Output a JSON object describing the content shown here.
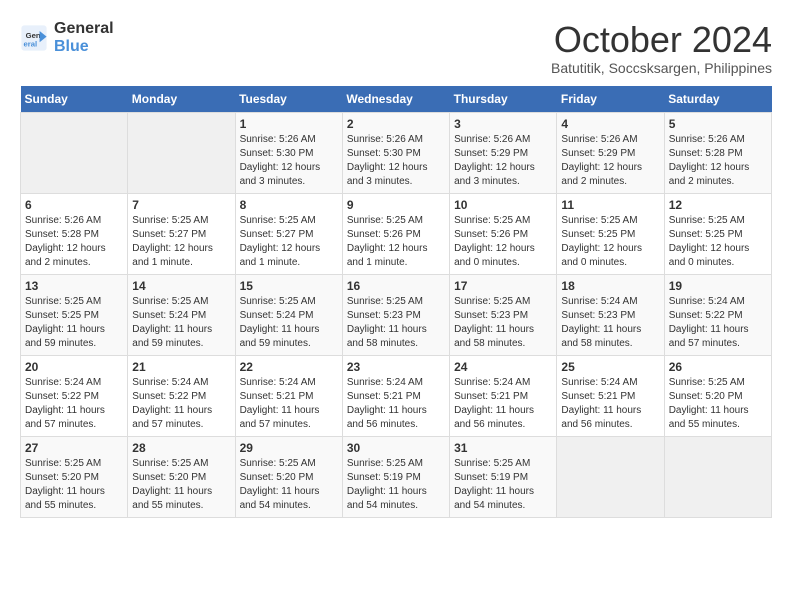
{
  "logo": {
    "line1": "General",
    "line2": "Blue"
  },
  "title": "October 2024",
  "subtitle": "Batutitik, Soccsksargen, Philippines",
  "weekdays": [
    "Sunday",
    "Monday",
    "Tuesday",
    "Wednesday",
    "Thursday",
    "Friday",
    "Saturday"
  ],
  "weeks": [
    [
      {
        "day": "",
        "info": ""
      },
      {
        "day": "",
        "info": ""
      },
      {
        "day": "1",
        "info": "Sunrise: 5:26 AM\nSunset: 5:30 PM\nDaylight: 12 hours and 3 minutes."
      },
      {
        "day": "2",
        "info": "Sunrise: 5:26 AM\nSunset: 5:30 PM\nDaylight: 12 hours and 3 minutes."
      },
      {
        "day": "3",
        "info": "Sunrise: 5:26 AM\nSunset: 5:29 PM\nDaylight: 12 hours and 3 minutes."
      },
      {
        "day": "4",
        "info": "Sunrise: 5:26 AM\nSunset: 5:29 PM\nDaylight: 12 hours and 2 minutes."
      },
      {
        "day": "5",
        "info": "Sunrise: 5:26 AM\nSunset: 5:28 PM\nDaylight: 12 hours and 2 minutes."
      }
    ],
    [
      {
        "day": "6",
        "info": "Sunrise: 5:26 AM\nSunset: 5:28 PM\nDaylight: 12 hours and 2 minutes."
      },
      {
        "day": "7",
        "info": "Sunrise: 5:25 AM\nSunset: 5:27 PM\nDaylight: 12 hours and 1 minute."
      },
      {
        "day": "8",
        "info": "Sunrise: 5:25 AM\nSunset: 5:27 PM\nDaylight: 12 hours and 1 minute."
      },
      {
        "day": "9",
        "info": "Sunrise: 5:25 AM\nSunset: 5:26 PM\nDaylight: 12 hours and 1 minute."
      },
      {
        "day": "10",
        "info": "Sunrise: 5:25 AM\nSunset: 5:26 PM\nDaylight: 12 hours and 0 minutes."
      },
      {
        "day": "11",
        "info": "Sunrise: 5:25 AM\nSunset: 5:25 PM\nDaylight: 12 hours and 0 minutes."
      },
      {
        "day": "12",
        "info": "Sunrise: 5:25 AM\nSunset: 5:25 PM\nDaylight: 12 hours and 0 minutes."
      }
    ],
    [
      {
        "day": "13",
        "info": "Sunrise: 5:25 AM\nSunset: 5:25 PM\nDaylight: 11 hours and 59 minutes."
      },
      {
        "day": "14",
        "info": "Sunrise: 5:25 AM\nSunset: 5:24 PM\nDaylight: 11 hours and 59 minutes."
      },
      {
        "day": "15",
        "info": "Sunrise: 5:25 AM\nSunset: 5:24 PM\nDaylight: 11 hours and 59 minutes."
      },
      {
        "day": "16",
        "info": "Sunrise: 5:25 AM\nSunset: 5:23 PM\nDaylight: 11 hours and 58 minutes."
      },
      {
        "day": "17",
        "info": "Sunrise: 5:25 AM\nSunset: 5:23 PM\nDaylight: 11 hours and 58 minutes."
      },
      {
        "day": "18",
        "info": "Sunrise: 5:24 AM\nSunset: 5:23 PM\nDaylight: 11 hours and 58 minutes."
      },
      {
        "day": "19",
        "info": "Sunrise: 5:24 AM\nSunset: 5:22 PM\nDaylight: 11 hours and 57 minutes."
      }
    ],
    [
      {
        "day": "20",
        "info": "Sunrise: 5:24 AM\nSunset: 5:22 PM\nDaylight: 11 hours and 57 minutes."
      },
      {
        "day": "21",
        "info": "Sunrise: 5:24 AM\nSunset: 5:22 PM\nDaylight: 11 hours and 57 minutes."
      },
      {
        "day": "22",
        "info": "Sunrise: 5:24 AM\nSunset: 5:21 PM\nDaylight: 11 hours and 57 minutes."
      },
      {
        "day": "23",
        "info": "Sunrise: 5:24 AM\nSunset: 5:21 PM\nDaylight: 11 hours and 56 minutes."
      },
      {
        "day": "24",
        "info": "Sunrise: 5:24 AM\nSunset: 5:21 PM\nDaylight: 11 hours and 56 minutes."
      },
      {
        "day": "25",
        "info": "Sunrise: 5:24 AM\nSunset: 5:21 PM\nDaylight: 11 hours and 56 minutes."
      },
      {
        "day": "26",
        "info": "Sunrise: 5:25 AM\nSunset: 5:20 PM\nDaylight: 11 hours and 55 minutes."
      }
    ],
    [
      {
        "day": "27",
        "info": "Sunrise: 5:25 AM\nSunset: 5:20 PM\nDaylight: 11 hours and 55 minutes."
      },
      {
        "day": "28",
        "info": "Sunrise: 5:25 AM\nSunset: 5:20 PM\nDaylight: 11 hours and 55 minutes."
      },
      {
        "day": "29",
        "info": "Sunrise: 5:25 AM\nSunset: 5:20 PM\nDaylight: 11 hours and 54 minutes."
      },
      {
        "day": "30",
        "info": "Sunrise: 5:25 AM\nSunset: 5:19 PM\nDaylight: 11 hours and 54 minutes."
      },
      {
        "day": "31",
        "info": "Sunrise: 5:25 AM\nSunset: 5:19 PM\nDaylight: 11 hours and 54 minutes."
      },
      {
        "day": "",
        "info": ""
      },
      {
        "day": "",
        "info": ""
      }
    ]
  ]
}
